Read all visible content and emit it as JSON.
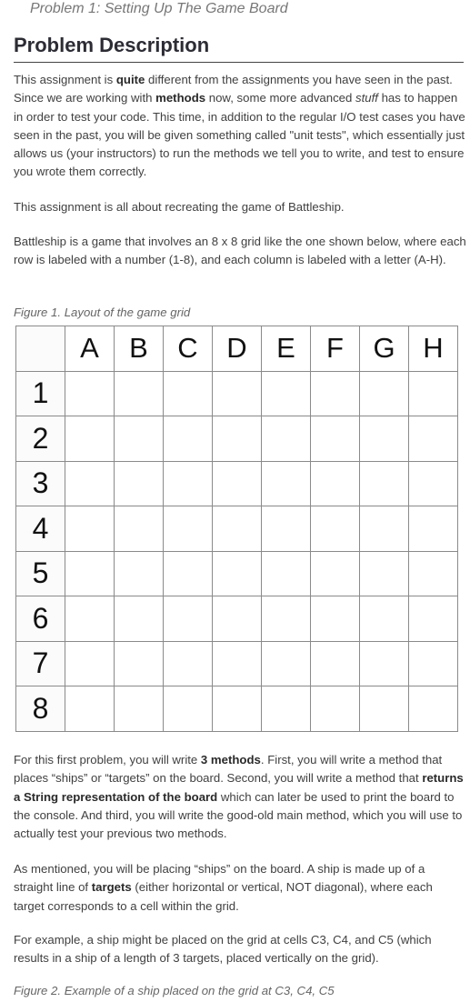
{
  "breadcrumb": "Problem 1: Setting Up The Game Board",
  "section_title": "Problem Description",
  "paragraphs": {
    "p1": [
      {
        "t": "This assignment is "
      },
      {
        "t": "quite",
        "b": true
      },
      {
        "t": " different from the assignments you have seen in the past. Since we are working with "
      },
      {
        "t": "methods",
        "b": true
      },
      {
        "t": " now, some more advanced "
      },
      {
        "t": "stuff",
        "i": true
      },
      {
        "t": " has to happen in order to test your code. This time, in addition to the regular I/O test cases you have seen in the past, you will be given something called \"unit tests\", which essentially just allows us (your instructors) to run the methods we tell you to write, and test to ensure you wrote them correctly."
      }
    ],
    "p2": [
      {
        "t": "This assignment is all about recreating the game of Battleship."
      }
    ],
    "p3": [
      {
        "t": "Battleship is a game that involves an 8 x 8 grid like the one shown below, where each row is labeled with a number (1-8), and each column is labeled with a letter (A-H)."
      }
    ],
    "p4": [
      {
        "t": "For this first problem, you will write "
      },
      {
        "t": "3 methods",
        "b": true
      },
      {
        "t": ". First, you will write a method that places “ships” or “targets” on the board. Second, you will write a method that "
      },
      {
        "t": "returns a String representation of the board",
        "b": true
      },
      {
        "t": " which can later be used to print the board to the console. And third, you will write the good-old main method, which you will use to actually test your previous two methods."
      }
    ],
    "p5": [
      {
        "t": "As mentioned, you will be placing “ships” on the board. A ship is made up of a straight line of "
      },
      {
        "t": "targets",
        "b": true
      },
      {
        "t": " (either horizontal or vertical, NOT diagonal), where each target corresponds to a cell within the grid."
      }
    ],
    "p6": [
      {
        "t": "For example, a ship might be placed on the grid at cells C3, C4, and C5 (which results in a ship of a length of 3 targets, placed vertically on the grid)."
      }
    ]
  },
  "figure1_caption": "Figure 1. Layout of the game grid",
  "figure2_caption": "Figure 2. Example of a ship placed on the grid at C3, C4, C5",
  "grid": {
    "columns": [
      "A",
      "B",
      "C",
      "D",
      "E",
      "F",
      "G",
      "H"
    ],
    "rows": [
      "1",
      "2",
      "3",
      "4",
      "5",
      "6",
      "7",
      "8"
    ]
  }
}
